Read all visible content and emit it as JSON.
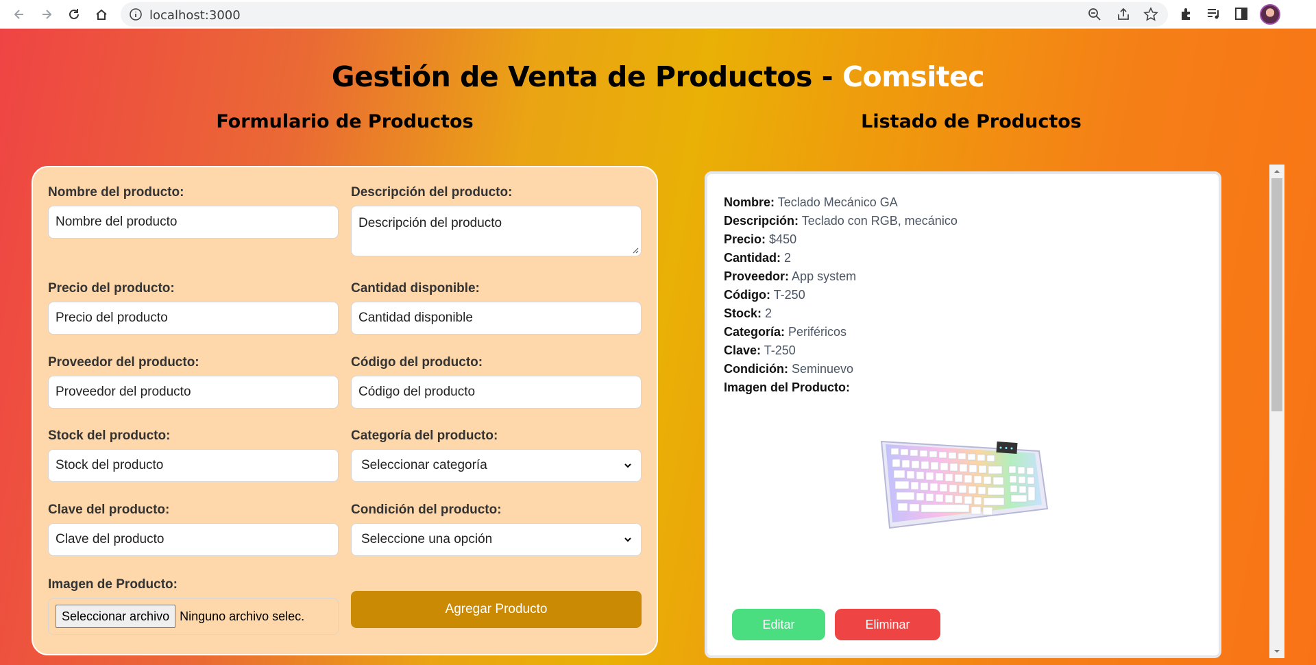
{
  "browser": {
    "url": "localhost:3000"
  },
  "header": {
    "title_main": "Gestión de Venta de Productos - ",
    "title_brand": "Comsitec"
  },
  "form": {
    "section_title": "Formulario de Productos",
    "fields": [
      {
        "label": "Nombre del producto:",
        "placeholder": "Nombre del producto"
      },
      {
        "label": "Descripción del producto:",
        "placeholder": "Descripción del producto"
      },
      {
        "label": "Precio del producto:",
        "placeholder": "Precio del producto"
      },
      {
        "label": "Cantidad disponible:",
        "placeholder": "Cantidad disponible"
      },
      {
        "label": "Proveedor del producto:",
        "placeholder": "Proveedor del producto"
      },
      {
        "label": "Código del producto:",
        "placeholder": "Código del producto"
      },
      {
        "label": "Stock del producto:",
        "placeholder": "Stock del producto"
      },
      {
        "label": "Categoría del producto:",
        "value": "Seleccionar categoría"
      },
      {
        "label": "Clave del producto:",
        "placeholder": "Clave del producto"
      },
      {
        "label": "Condición del producto:",
        "value": "Seleccione una opción"
      }
    ],
    "image_label": "Imagen de Producto:",
    "file_button": "Seleccionar archivo",
    "file_status": "Ninguno archivo selec.",
    "submit_label": "Agregar Producto"
  },
  "list": {
    "section_title": "Listado de Productos",
    "product": {
      "rows": [
        {
          "key": "Nombre:",
          "value": "Teclado Mecánico GA"
        },
        {
          "key": "Descripción:",
          "value": "Teclado con RGB, mecánico"
        },
        {
          "key": "Precio:",
          "value": "$450"
        },
        {
          "key": "Cantidad:",
          "value": "2"
        },
        {
          "key": "Proveedor:",
          "value": "App system"
        },
        {
          "key": "Código:",
          "value": "T-250"
        },
        {
          "key": "Stock:",
          "value": "2"
        },
        {
          "key": "Categoría:",
          "value": "Periféricos"
        },
        {
          "key": "Clave:",
          "value": "T-250"
        },
        {
          "key": "Condición:",
          "value": "Seminuevo"
        }
      ],
      "image_label": "Imagen del Producto:",
      "edit_label": "Editar",
      "delete_label": "Eliminar"
    }
  },
  "colors": {
    "form_bg": "#fed7aa",
    "submit_bg": "#ca8a04",
    "edit_bg": "#4ade80",
    "delete_bg": "#ef4444"
  }
}
